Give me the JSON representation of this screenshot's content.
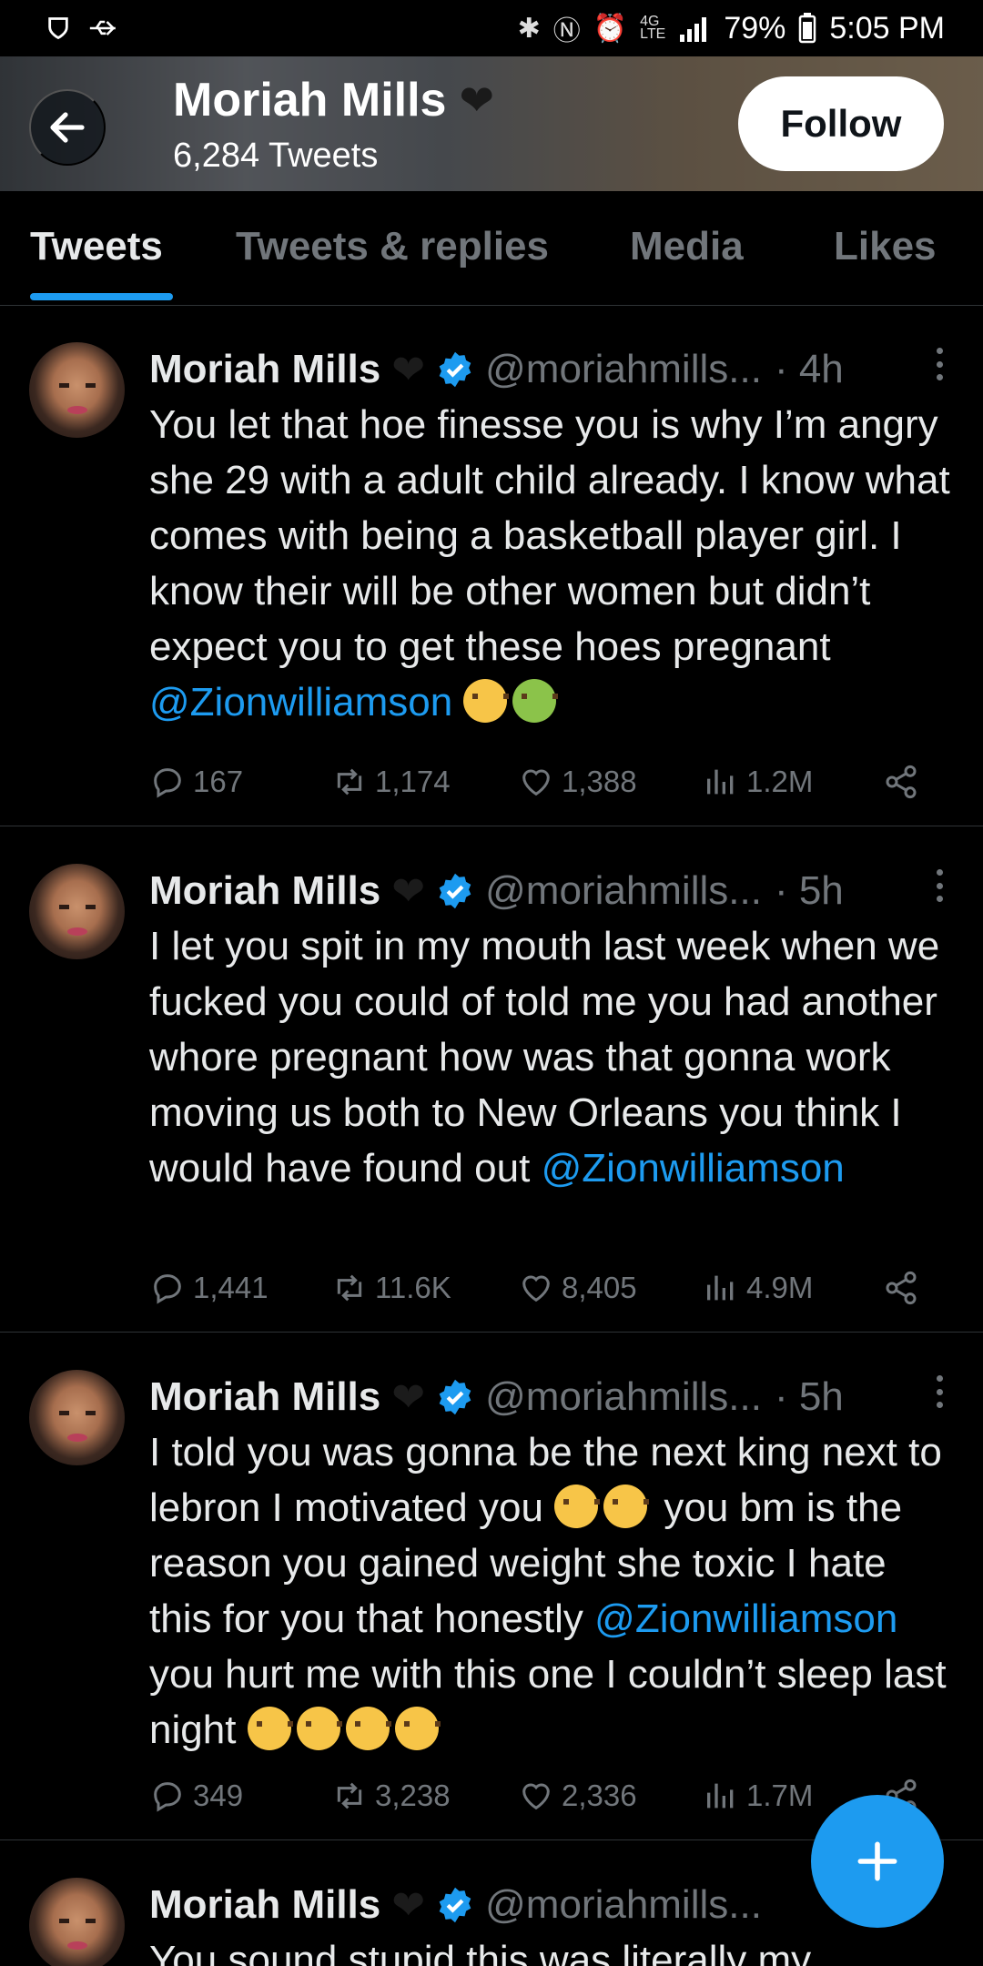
{
  "status_bar": {
    "left_icons": [
      "shield-icon",
      "usb-icon"
    ],
    "battery": "79%",
    "time": "5:05 PM",
    "network": "4G LTE"
  },
  "header": {
    "name": "Moriah Mills",
    "tweet_count": "6,284 Tweets",
    "follow_label": "Follow"
  },
  "tabs": [
    {
      "label": "Tweets",
      "active": true
    },
    {
      "label": "Tweets & replies",
      "active": false
    },
    {
      "label": "Media",
      "active": false
    },
    {
      "label": "Likes",
      "active": false
    }
  ],
  "tweets": [
    {
      "name": "Moriah Mills",
      "handle": "@moriahmills...",
      "time": "· 4h",
      "text": "You let that hoe finesse you is why I’m angry she 29 with a adult child already. I know what comes with being a basketball player girl. I know their will be other women but didn’t expect you to get these hoes pregnant",
      "mention": "@Zionwilliamson",
      "text_after": "",
      "replies": "167",
      "retweets": "1,174",
      "likes": "1,388",
      "views": "1.2M"
    },
    {
      "name": "Moriah Mills",
      "handle": "@moriahmills...",
      "time": "· 5h",
      "text": "I let you spit in my mouth last week when we fucked you could of told me you had another whore pregnant how was that gonna work moving us both to New Orleans you think I would have found out",
      "mention": "@Zionwilliamson",
      "text_after": "",
      "replies": "1,441",
      "retweets": "11.6K",
      "likes": "8,405",
      "views": "4.9M"
    },
    {
      "name": "Moriah Mills",
      "handle": "@moriahmills...",
      "time": "· 5h",
      "text": "I told you was gonna be the next king next to lebron I motivated you",
      "text_mid": "you bm is the reason you gained weight she toxic I hate this for you that honestly",
      "mention": "@Zionwilliamson",
      "text_after": "you hurt me with this one I couldn’t sleep last night",
      "replies": "349",
      "retweets": "3,238",
      "likes": "2,336",
      "views": "1.7M"
    },
    {
      "name": "Moriah Mills",
      "handle": "@moriahmills...",
      "time": "",
      "text": "You sound stupid this was literally my"
    }
  ],
  "colors": {
    "accent": "#1d9bf0",
    "muted": "#71767b",
    "background": "#000000"
  }
}
